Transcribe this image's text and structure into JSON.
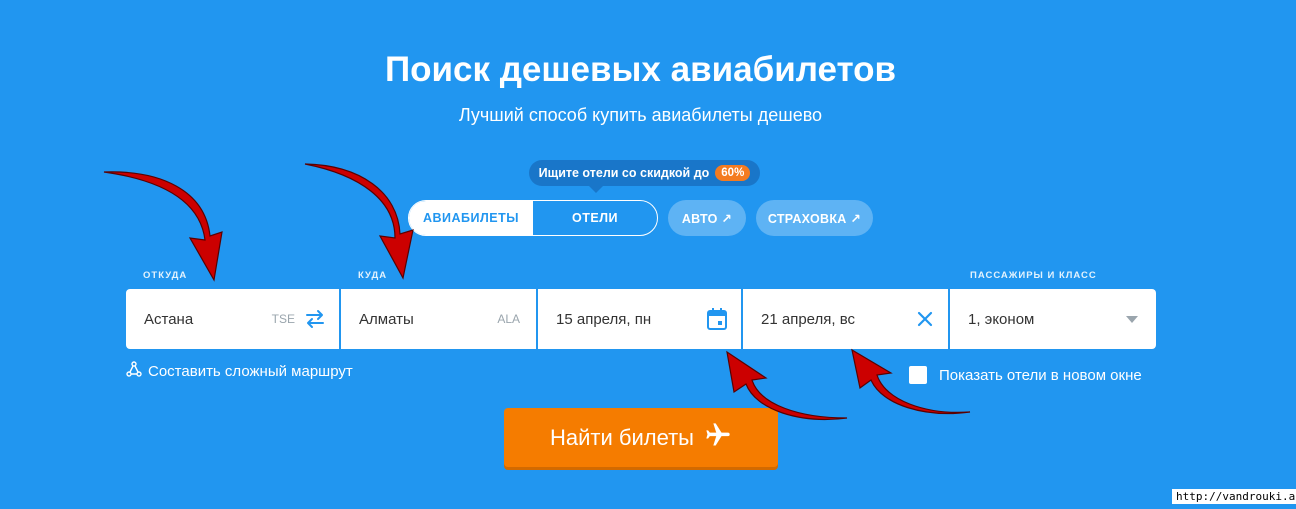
{
  "header": {
    "title": "Поиск дешевых авиабилетов",
    "subtitle": "Лучший способ купить авиабилеты дешево"
  },
  "promo": {
    "text": "Ищите отели со скидкой до",
    "badge": "60%"
  },
  "tabs": [
    {
      "label": "АВИАБИЛЕТЫ",
      "active": true
    },
    {
      "label": "ОТЕЛИ",
      "active": false
    }
  ],
  "external_links": [
    {
      "label": "АВТО ↗"
    },
    {
      "label": "СТРАХОВКА ↗"
    }
  ],
  "labels": {
    "origin": "ОТКУДА",
    "destination": "КУДА",
    "passengers": "ПАССАЖИРЫ И КЛАСС"
  },
  "form": {
    "origin": {
      "city": "Астана",
      "iata": "TSE"
    },
    "destination": {
      "city": "Алматы",
      "iata": "ALA"
    },
    "depart_date": "15 апреля, пн",
    "return_date": "21 апреля, вс",
    "passengers": "1, эконом"
  },
  "options": {
    "complex_route": "Составить сложный маршрут",
    "show_hotels": "Показать отели в новом окне"
  },
  "search_button": {
    "label": "Найти билеты"
  },
  "watermark": "http://vandrouki.asia",
  "colors": {
    "background": "#2196f0",
    "accent_orange": "#f57c00",
    "annotation_arrows": "#cc0000"
  }
}
